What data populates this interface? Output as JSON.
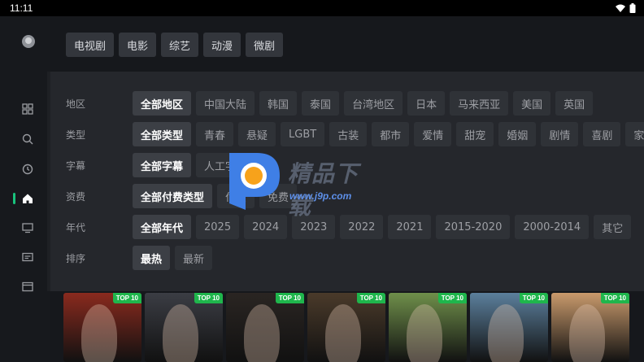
{
  "status_bar": {
    "time": "11:11",
    "icons": [
      "wifi-icon",
      "battery-icon"
    ]
  },
  "sidebar": {
    "items": [
      {
        "name": "avatar"
      },
      {
        "name": "grid-icon"
      },
      {
        "name": "search-icon"
      },
      {
        "name": "history-icon"
      },
      {
        "name": "home-icon",
        "active": true
      },
      {
        "name": "tv-icon"
      },
      {
        "name": "message-icon"
      },
      {
        "name": "calendar-icon"
      }
    ],
    "active_color": "#19c37d"
  },
  "top_tabs": [
    "电视剧",
    "电影",
    "综艺",
    "动漫",
    "微剧"
  ],
  "filters": [
    {
      "label": "地区",
      "options": [
        "全部地区",
        "中国大陆",
        "韩国",
        "泰国",
        "台湾地区",
        "日本",
        "马来西亚",
        "美国",
        "英国"
      ],
      "selected": 0
    },
    {
      "label": "类型",
      "options": [
        "全部类型",
        "青春",
        "悬疑",
        "LGBT",
        "古装",
        "都市",
        "爱情",
        "甜宠",
        "婚姻",
        "剧情",
        "喜剧",
        "家"
      ],
      "selected": 0
    },
    {
      "label": "字幕",
      "options": [
        "全部字幕",
        "人工字幕"
      ],
      "selected": 0
    },
    {
      "label": "资费",
      "options": [
        "全部付费类型",
        "付费",
        "免费"
      ],
      "selected": 0
    },
    {
      "label": "年代",
      "options": [
        "全部年代",
        "2025",
        "2024",
        "2023",
        "2022",
        "2021",
        "2015-2020",
        "2000-2014",
        "其它"
      ],
      "selected": 0
    },
    {
      "label": "排序",
      "options": [
        "最热",
        "最新"
      ],
      "selected": 0
    }
  ],
  "posters": [
    {
      "badge": "TOP 10",
      "bg": "#8a2a1e"
    },
    {
      "badge": "TOP 10",
      "bg": "#3b3d44"
    },
    {
      "badge": "TOP 10",
      "bg": "#2a2522"
    },
    {
      "badge": "TOP 10",
      "bg": "#4a3a2a"
    },
    {
      "badge": "TOP 10",
      "bg": "#6f8f4a"
    },
    {
      "badge": "TOP 10",
      "bg": "#5b7f9c"
    },
    {
      "badge": "TOP 10",
      "bg": "#c99a6c"
    }
  ],
  "watermark": {
    "text": "精品下载",
    "url": "www.j9p.com"
  },
  "colors": {
    "badge": "#1fb64c",
    "accent": "#19c37d",
    "background": "#16181c",
    "panel": "#25272c"
  }
}
